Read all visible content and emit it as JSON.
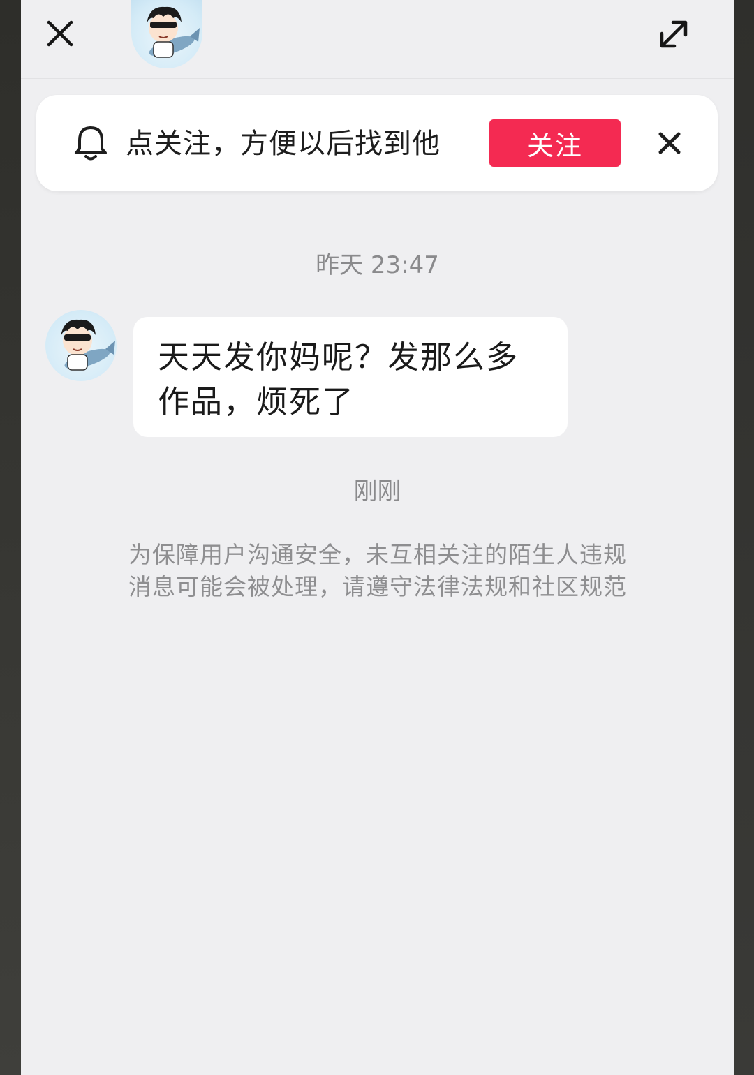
{
  "header": {
    "close_icon": "close-icon",
    "expand_icon": "expand-icon",
    "avatar": "cartoon-boy-with-sunglasses-riding-fish"
  },
  "follow_prompt": {
    "bell_icon": "bell-icon",
    "text": "点关注，方便以后找到他",
    "follow_label": "关注",
    "follow_color": "#f42a52",
    "dismiss_icon": "close-icon"
  },
  "chat": {
    "timestamp_1": "昨天 23:47",
    "message_text": "天天发你妈呢？发那么多作品，烦死了",
    "timestamp_2": "刚刚",
    "notice": "为保障用户沟通安全，未互相关注的陌生人违规消息可能会被处理，请遵守法律法规和社区规范"
  }
}
